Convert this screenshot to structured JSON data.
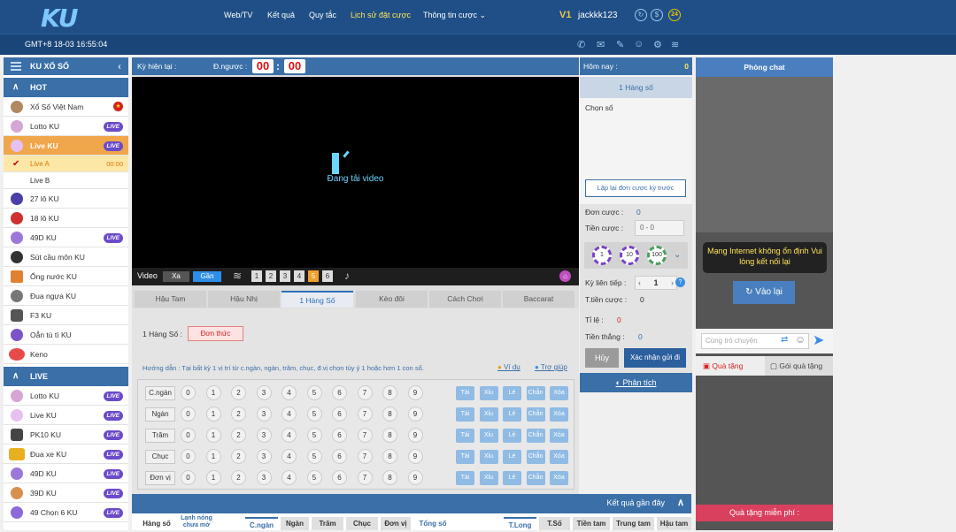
{
  "header": {
    "logo": "KU",
    "nav": [
      "Web/TV",
      "Kết quả",
      "Quy tắc",
      "Lịch sử đặt cược",
      "Thông tin cược"
    ],
    "vip": "V1",
    "username": "jackkk123",
    "badge24": "24",
    "clock": "GMT+8 18-03 16:55:04"
  },
  "sidebar": {
    "title": "KU XỔ SỐ",
    "hot_label": "HOT",
    "live_label": "LIVE",
    "live_tag": "LIVE",
    "hot_items": [
      "Xổ Số Việt Nam",
      "Lotto KU",
      "Live KU",
      "27 lô KU",
      "18 lô KU",
      "49D KU",
      "Sút cầu môn KU",
      "Ống nước KU",
      "Đua ngựa KU",
      "F3 KU",
      "Oẳn tù tì KU",
      "Keno"
    ],
    "sub_items": [
      "Live A",
      "Live B"
    ],
    "sub_time": "00:00",
    "live_items": [
      "Lotto KU",
      "Live KU",
      "PK10 KU",
      "Đua xe KU",
      "49D KU",
      "39D KU",
      "49 Chọn 6 KU"
    ]
  },
  "center": {
    "ky_label": "Kỳ hiện tại :",
    "dnguoc_label": "Đ.ngược :",
    "mm": "00",
    "ss": "00",
    "loading": "Đang tải video",
    "video_label": "Video",
    "xa": "Xa",
    "gan": "Gần",
    "nums": [
      "1",
      "2",
      "3",
      "4",
      "5",
      "6"
    ],
    "tabs": [
      "Hậu Tam",
      "Hậu Nhị",
      "1 Hàng Số",
      "Kèo đôi",
      "Cách Chơi",
      "Baccarat"
    ],
    "mode_label": "1 Hàng Số :",
    "mode_btn": "Đơn thức",
    "hint": "Hướng dẫn : Tại bất kỳ 1 vị trí từ c.ngàn, ngàn, trăm, chục, đ.vị chọn tùy ý 1 hoặc hơn 1 con số.",
    "vidu": "Ví dụ",
    "trogiup": "Trợ giúp",
    "rows": [
      "C.ngàn",
      "Ngàn",
      "Trăm",
      "Chục",
      "Đơn vị"
    ],
    "digits": [
      "0",
      "1",
      "2",
      "3",
      "4",
      "5",
      "6",
      "7",
      "8",
      "9"
    ],
    "side_btns": [
      "Tài",
      "Xỉu",
      "Lẻ",
      "Chẵn",
      "Xóa"
    ]
  },
  "right": {
    "hom_nay": "Hôm nay :",
    "hom_nay_val": "0",
    "mode": "1 Hàng số",
    "chon_so": "Chọn số",
    "lap_lai": "Lập lại đơn cược kỳ trước",
    "don_cuoc": "Đơn cược :",
    "don_cuoc_val": "0",
    "tien_cuoc": "Tiền cược :",
    "tien_cuoc_val": "0 - 0",
    "chips": [
      "1",
      "10",
      "100"
    ],
    "ky_lien_tiep": "Kỳ liên tiếp :",
    "ky_val": "1",
    "t_tien_cuoc": "T.tiền cược :",
    "t_tien_val": "0",
    "ti_le": "Tỉ lệ :",
    "ti_le_val": "0",
    "tien_thang": "Tiền thắng :",
    "tien_thang_val": "0",
    "huy": "Hủy",
    "xac_nhan": "Xác nhận gửi đi",
    "phan_tich": "Phân tích"
  },
  "chat": {
    "title": "Phòng chat",
    "error": "Mạng Internet không ổn định Vui lòng kết nối lại",
    "retry": "Vào lại",
    "placeholder": "Cùng trò chuyện",
    "qua_tang": "Quà tặng",
    "goi_qua": "Gói quà tặng",
    "free": "Quà tặng miễn phí :"
  },
  "bottom": {
    "results": "Kết quả gần đây",
    "tabs": [
      "Hàng số",
      "Lạnh nóng chưa mở",
      "C.ngàn",
      "Ngàn",
      "Trăm",
      "Chục",
      "Đơn vị",
      "Tổng số",
      "T.Long",
      "T.Số",
      "Tiền tam",
      "Trung tam",
      "Hậu tam"
    ]
  }
}
